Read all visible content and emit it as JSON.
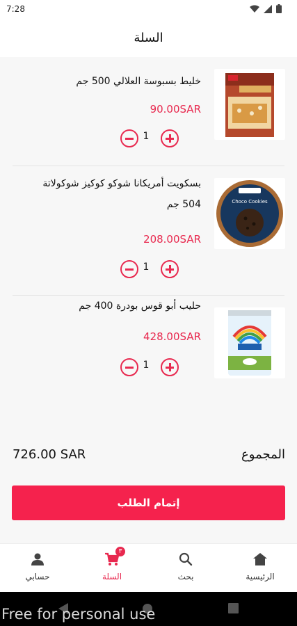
{
  "status_bar": {
    "time": "7:28"
  },
  "header": {
    "title": "السلة"
  },
  "cart": {
    "items": [
      {
        "name": "خليط بسبوسة العلالي 500 جم",
        "price": "90.00SAR",
        "quantity": "1",
        "image": "basbousa-mix-box"
      },
      {
        "name": "بسكويت أمريكانا شوكو كوكيز شوكولاتة 504 جم",
        "price": "208.00SAR",
        "quantity": "1",
        "image": "choco-cookies-tin"
      },
      {
        "name": "حليب أبو قوس بودرة 400 جم",
        "price": "428.00SAR",
        "quantity": "1",
        "image": "rainbow-milk-can"
      }
    ]
  },
  "summary": {
    "total_label": "المجموع",
    "total_value": "726.00 SAR"
  },
  "checkout": {
    "label": "إتمام الطلب"
  },
  "bottom_nav": {
    "items": [
      {
        "label": "الرئيسية",
        "icon": "home-icon"
      },
      {
        "label": "بحث",
        "icon": "search-icon"
      },
      {
        "label": "السلة",
        "icon": "cart-icon",
        "badge": "٣"
      },
      {
        "label": "حسابي",
        "icon": "person-icon"
      }
    ]
  },
  "watermark": "Free for personal use",
  "colors": {
    "accent": "#e8294f",
    "button": "#f5224d"
  }
}
